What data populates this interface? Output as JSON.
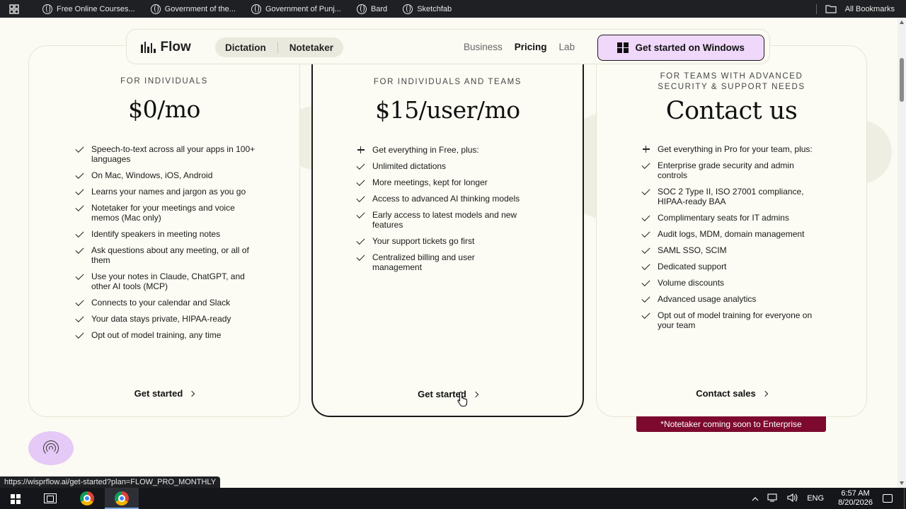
{
  "browser": {
    "bookmarks": [
      {
        "label": "Free Online Courses...",
        "icon": "globe-icon"
      },
      {
        "label": "Government of the...",
        "icon": "globe-icon"
      },
      {
        "label": "Government of Punj...",
        "icon": "globe-icon"
      },
      {
        "label": "Bard",
        "icon": "globe-icon"
      },
      {
        "label": "Sketchfab",
        "icon": "globe-icon"
      }
    ],
    "all_bookmarks": "All Bookmarks",
    "status_url": "https://wisprflow.ai/get-started?plan=FLOW_PRO_MONTHLY"
  },
  "nav": {
    "logo": "Flow",
    "segments": [
      "Dictation",
      "Notetaker"
    ],
    "links": [
      "Business",
      "Pricing",
      "Lab"
    ],
    "active_link": "Pricing",
    "cta": "Get started on Windows"
  },
  "plans": {
    "free": {
      "tier": "FOR INDIVIDUALS",
      "price": "$0/mo",
      "features": [
        {
          "mark": "check",
          "text": "Speech-to-text across all your apps in 100+ languages"
        },
        {
          "mark": "check",
          "text": "On Mac, Windows, iOS, Android"
        },
        {
          "mark": "check",
          "text": "Learns your names and jargon as you go"
        },
        {
          "mark": "check",
          "text": "Notetaker for your meetings and voice memos (Mac only)"
        },
        {
          "mark": "check",
          "text": "Identify speakers in meeting notes"
        },
        {
          "mark": "check",
          "text": "Ask questions about any meeting, or all of them"
        },
        {
          "mark": "check",
          "text": "Use your notes in Claude, ChatGPT, and other AI tools (MCP)"
        },
        {
          "mark": "check",
          "text": "Connects to your calendar and Slack"
        },
        {
          "mark": "check",
          "text": "Your data stays private, HIPAA-ready"
        },
        {
          "mark": "check",
          "text": "Opt out of model training, any time"
        }
      ],
      "cta": "Get started"
    },
    "pro": {
      "tier": "FOR INDIVIDUALS AND TEAMS",
      "price": "$15/user/mo",
      "features": [
        {
          "mark": "plus",
          "text": "Get everything in Free, plus:"
        },
        {
          "mark": "check",
          "text": "Unlimited dictations"
        },
        {
          "mark": "check",
          "text": "More meetings, kept for longer"
        },
        {
          "mark": "check",
          "text": "Access to advanced AI thinking models"
        },
        {
          "mark": "check",
          "text": "Early access to latest models and new features"
        },
        {
          "mark": "check",
          "text": "Your support tickets go first"
        },
        {
          "mark": "check",
          "text": "Centralized billing and user management"
        }
      ],
      "cta": "Get started"
    },
    "enterprise": {
      "tier_line1": "FOR TEAMS WITH ADVANCED",
      "tier_line2": "SECURITY & SUPPORT NEEDS",
      "price": "Contact us",
      "features": [
        {
          "mark": "plus",
          "text": "Get everything in Pro for your team, plus:"
        },
        {
          "mark": "check",
          "text": "Enterprise grade security and admin controls"
        },
        {
          "mark": "check",
          "text": "SOC 2 Type II, ISO 27001 compliance, HIPAA-ready BAA"
        },
        {
          "mark": "check",
          "text": "Complimentary seats for IT admins"
        },
        {
          "mark": "check",
          "text": "Audit logs, MDM, domain management"
        },
        {
          "mark": "check",
          "text": "SAML SSO, SCIM"
        },
        {
          "mark": "check",
          "text": "Dedicated support"
        },
        {
          "mark": "check",
          "text": "Volume discounts"
        },
        {
          "mark": "check",
          "text": "Advanced usage analytics"
        },
        {
          "mark": "check",
          "text": "Opt out of model training for everyone on your team"
        }
      ],
      "cta": "Contact sales",
      "notice": "*Notetaker coming soon to Enterprise"
    }
  },
  "taskbar": {
    "language": "ENG",
    "time": "6:57 AM",
    "date": "8/20/2026"
  },
  "colors": {
    "background": "#fbfbf3",
    "accent_cta": "#f0d8fa",
    "notice": "#7d0a2e"
  }
}
